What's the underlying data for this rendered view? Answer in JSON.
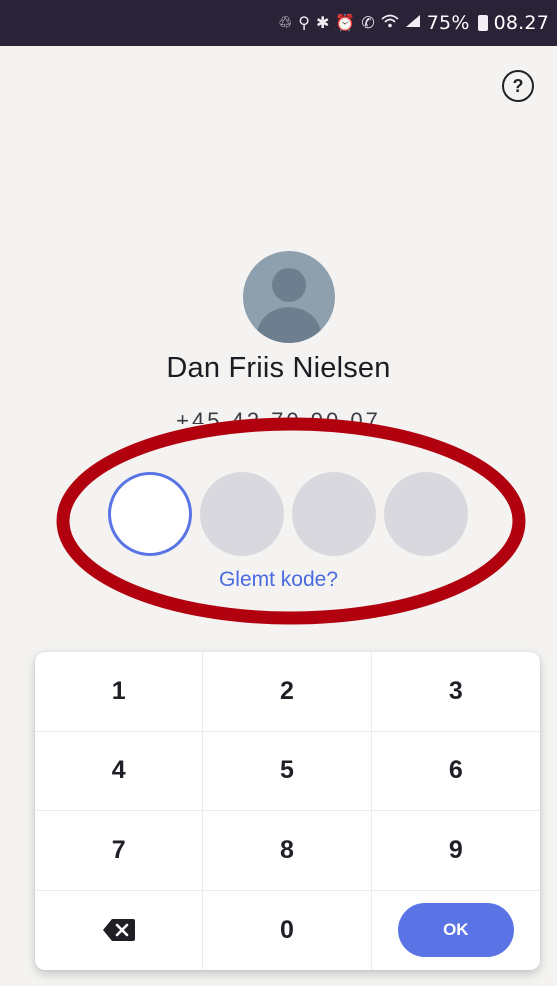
{
  "status_bar": {
    "icons": [
      "recycle-icon",
      "location-icon",
      "bluetooth-icon",
      "alarm-icon",
      "call-icon",
      "wifi-icon",
      "signal-icon"
    ],
    "battery": "75%",
    "time": "08.27"
  },
  "help": {
    "glyph": "?"
  },
  "user": {
    "name": "Dan Friis Nielsen",
    "phone": "+45 42 70 90 07"
  },
  "pin": {
    "length": 4,
    "filled": 0
  },
  "forgot_label": "Glemt kode?",
  "keypad": {
    "keys": [
      "1",
      "2",
      "3",
      "4",
      "5",
      "6",
      "7",
      "8",
      "9"
    ],
    "zero": "0",
    "ok": "OK"
  },
  "colors": {
    "accent": "#5a74e6",
    "status_bar": "#2a2236",
    "annotation": "#b1000e",
    "background": "#f4f3f1"
  }
}
